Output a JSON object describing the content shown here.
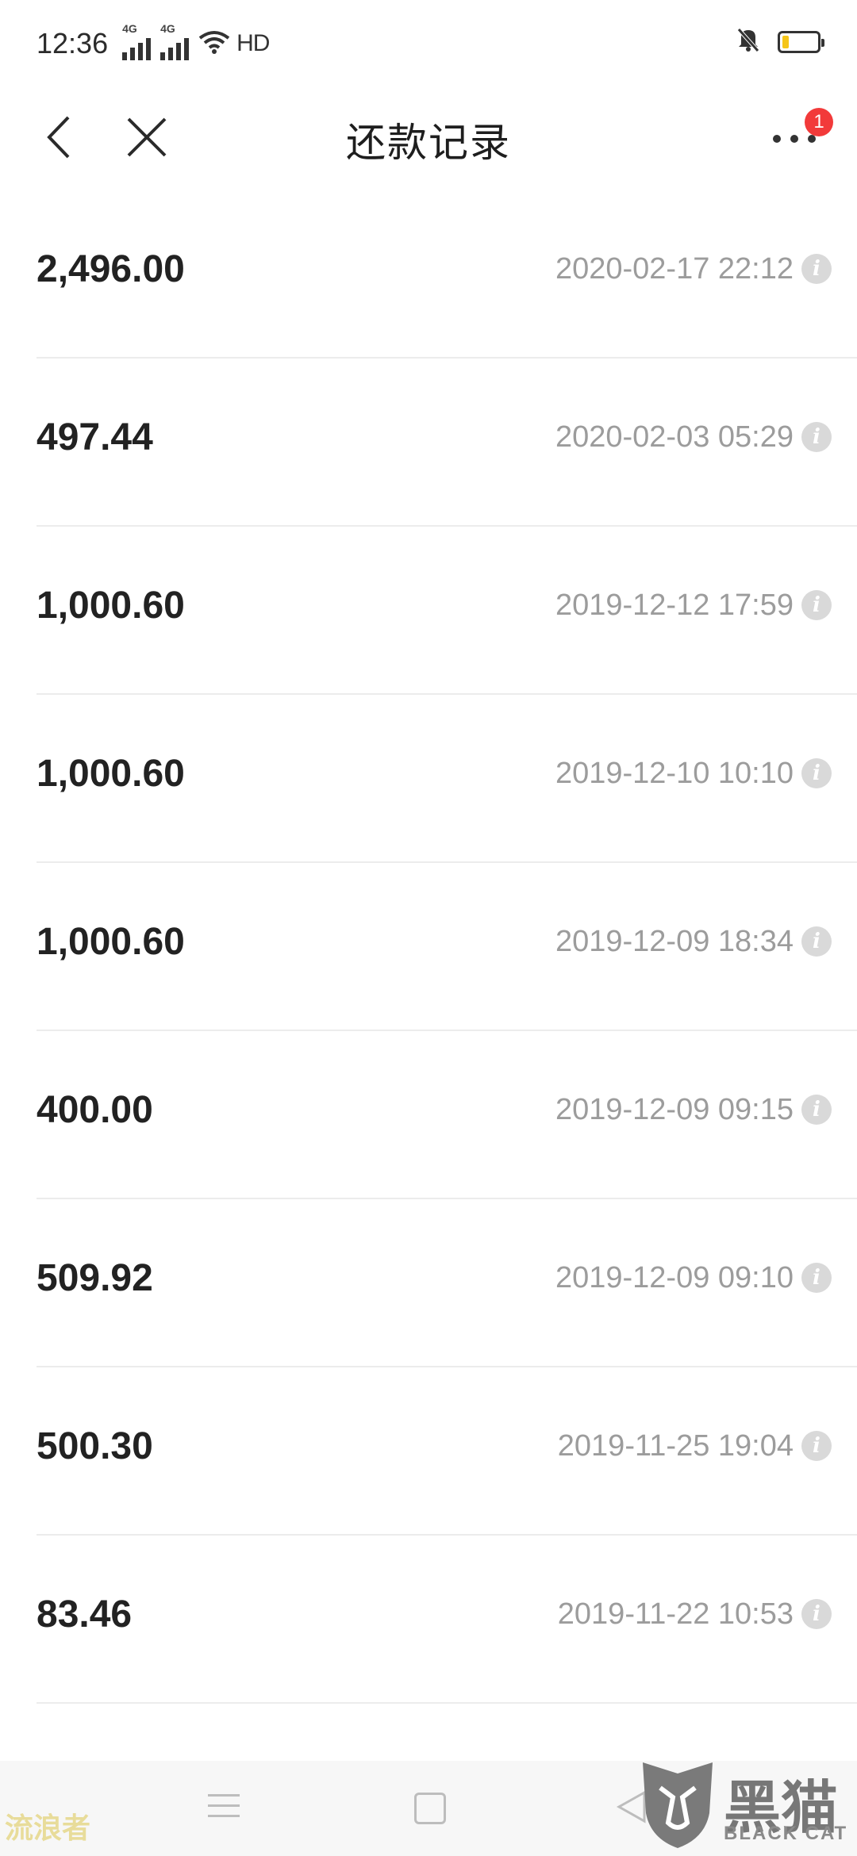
{
  "status_bar": {
    "time": "12:36",
    "signal1_label": "4G",
    "signal2_label": "4G",
    "hd_label": "HD",
    "icons": [
      "signal-icon",
      "signal-icon",
      "wifi-icon",
      "mute-bell-icon",
      "battery-icon"
    ],
    "battery_color": "#f5c518"
  },
  "nav": {
    "title": "还款记录",
    "badge_count": "1",
    "badge_color": "#f23a3a"
  },
  "records": [
    {
      "amount": "2,496.00",
      "time": "2020-02-17 22:12"
    },
    {
      "amount": "497.44",
      "time": "2020-02-03 05:29"
    },
    {
      "amount": "1,000.60",
      "time": "2019-12-12 17:59"
    },
    {
      "amount": "1,000.60",
      "time": "2019-12-10 10:10"
    },
    {
      "amount": "1,000.60",
      "time": "2019-12-09 18:34"
    },
    {
      "amount": "400.00",
      "time": "2019-12-09 09:15"
    },
    {
      "amount": "509.92",
      "time": "2019-12-09 09:10"
    },
    {
      "amount": "500.30",
      "time": "2019-11-25 19:04"
    },
    {
      "amount": "83.46",
      "time": "2019-11-22 10:53"
    }
  ],
  "info_glyph": "i",
  "watermarks": {
    "left": "流浪者",
    "right_zh": "黑猫",
    "right_en": "BLACK CAT"
  }
}
